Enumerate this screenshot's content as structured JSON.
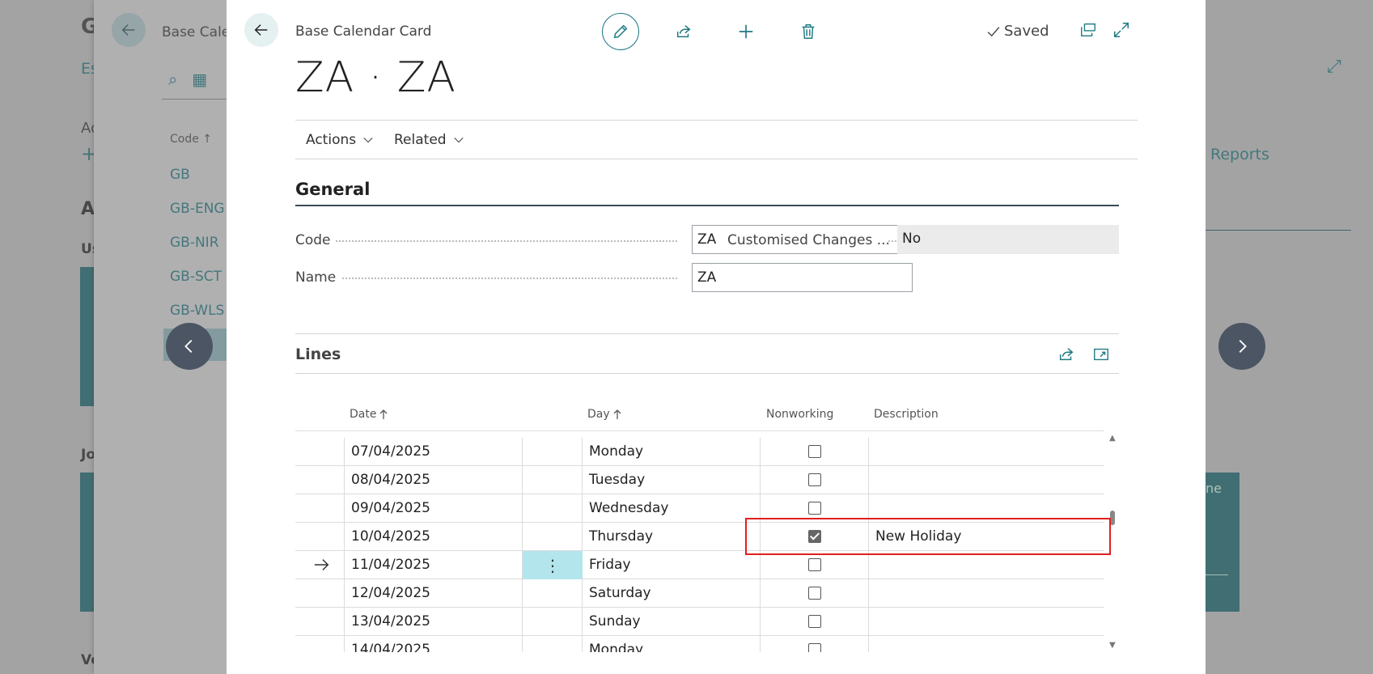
{
  "background": {
    "title": "G",
    "subtitle": "Es",
    "actions_label": "Ac",
    "section": "Ac",
    "user_label": "Us",
    "jobs_label": "Jo",
    "ve_label": "Ve",
    "reports_link": "Reports",
    "tile_text": "ne"
  },
  "bg_list": {
    "title": "Base Caler",
    "column_header": "Code ↑",
    "items": [
      "GB",
      "GB-ENG",
      "GB-NIR",
      "GB-SCT",
      "GB-WLS"
    ]
  },
  "header": {
    "card_title": "Base Calendar Card",
    "saved_label": "Saved",
    "record_title": "ZA · ZA"
  },
  "actionbar": {
    "actions_label": "Actions",
    "related_label": "Related"
  },
  "general": {
    "title": "General",
    "code_label": "Code",
    "code_value": "ZA",
    "name_label": "Name",
    "name_value": "ZA",
    "customised_label": "Customised Changes ...",
    "customised_value": "No"
  },
  "lines": {
    "title": "Lines",
    "columns": {
      "date": "Date",
      "day": "Day",
      "nonworking": "Nonworking",
      "description": "Description"
    },
    "rows": [
      {
        "date": "07/04/2025",
        "day": "Monday",
        "nonworking": false,
        "description": ""
      },
      {
        "date": "08/04/2025",
        "day": "Tuesday",
        "nonworking": false,
        "description": ""
      },
      {
        "date": "09/04/2025",
        "day": "Wednesday",
        "nonworking": false,
        "description": ""
      },
      {
        "date": "10/04/2025",
        "day": "Thursday",
        "nonworking": true,
        "description": "New Holiday"
      },
      {
        "date": "11/04/2025",
        "day": "Friday",
        "nonworking": false,
        "description": "",
        "selected": true
      },
      {
        "date": "12/04/2025",
        "day": "Saturday",
        "nonworking": false,
        "description": ""
      },
      {
        "date": "13/04/2025",
        "day": "Sunday",
        "nonworking": false,
        "description": ""
      },
      {
        "date": "14/04/2025",
        "day": "Monday",
        "nonworking": false,
        "description": ""
      }
    ]
  },
  "colors": {
    "accent": "#1f7a83",
    "highlight": "#e0201e",
    "selected_row_menu": "#b3e5ec"
  }
}
